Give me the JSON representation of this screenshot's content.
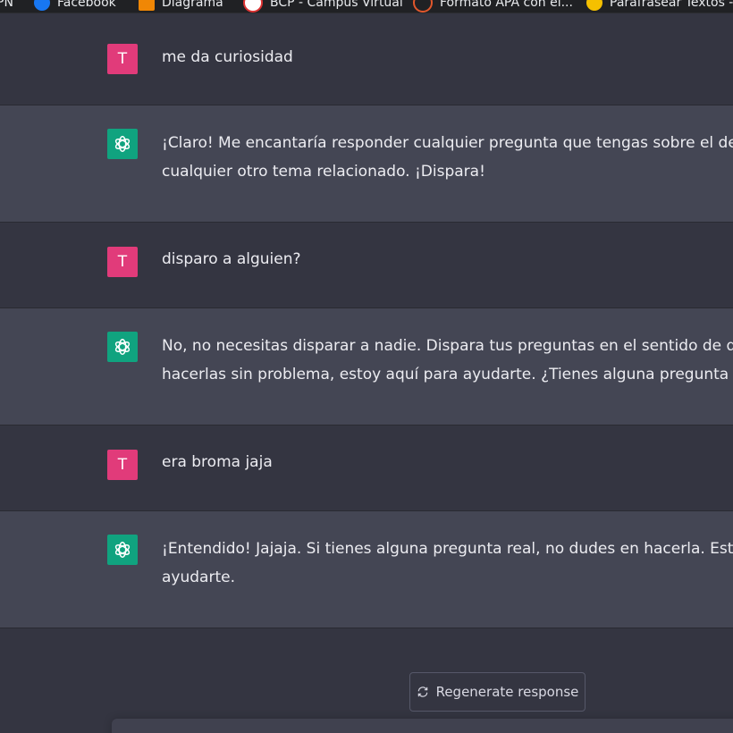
{
  "bookmarks": [
    {
      "label": "PN",
      "icon": "none"
    },
    {
      "label": "Facebook",
      "icon": "facebook-icon"
    },
    {
      "label": "Diagrama",
      "icon": "diagram-icon"
    },
    {
      "label": "BCP - Campus Virtual",
      "icon": "bcp-icon"
    },
    {
      "label": "Formato APA con el...",
      "icon": "apa-icon"
    },
    {
      "label": "Parafrasear Textos -...",
      "icon": "moon-icon"
    }
  ],
  "conversation": [
    {
      "role": "user",
      "avatar": "T",
      "lines": [
        "me da curiosidad"
      ]
    },
    {
      "role": "assistant",
      "avatar": "openai-logo-icon",
      "lines": [
        "¡Claro! Me encantaría responder cualquier pregunta que tengas sobre el desarrol",
        "cualquier otro tema relacionado. ¡Dispara!"
      ]
    },
    {
      "role": "user",
      "avatar": "T",
      "lines": [
        "disparo a alguien?"
      ]
    },
    {
      "role": "assistant",
      "avatar": "openai-logo-icon",
      "lines": [
        "No, no necesitas disparar a nadie. Dispara tus preguntas en el sentido de que pu",
        "hacerlas sin problema, estoy aquí para ayudarte. ¿Tienes alguna pregunta en mer"
      ]
    },
    {
      "role": "user",
      "avatar": "T",
      "lines": [
        "era broma jaja"
      ]
    },
    {
      "role": "assistant",
      "avatar": "openai-logo-icon",
      "lines": [
        "¡Entendido! Jajaja. Si tienes alguna pregunta real, no dudes en hacerla. Estoy aqu",
        "ayudarte."
      ]
    }
  ],
  "regenerate": {
    "label": "Regenerate response",
    "icon": "refresh-icon"
  },
  "colors": {
    "user_bg": "#343541",
    "assistant_bg": "#444654",
    "user_avatar": "#e13b7a",
    "assistant_avatar": "#10a37f"
  }
}
